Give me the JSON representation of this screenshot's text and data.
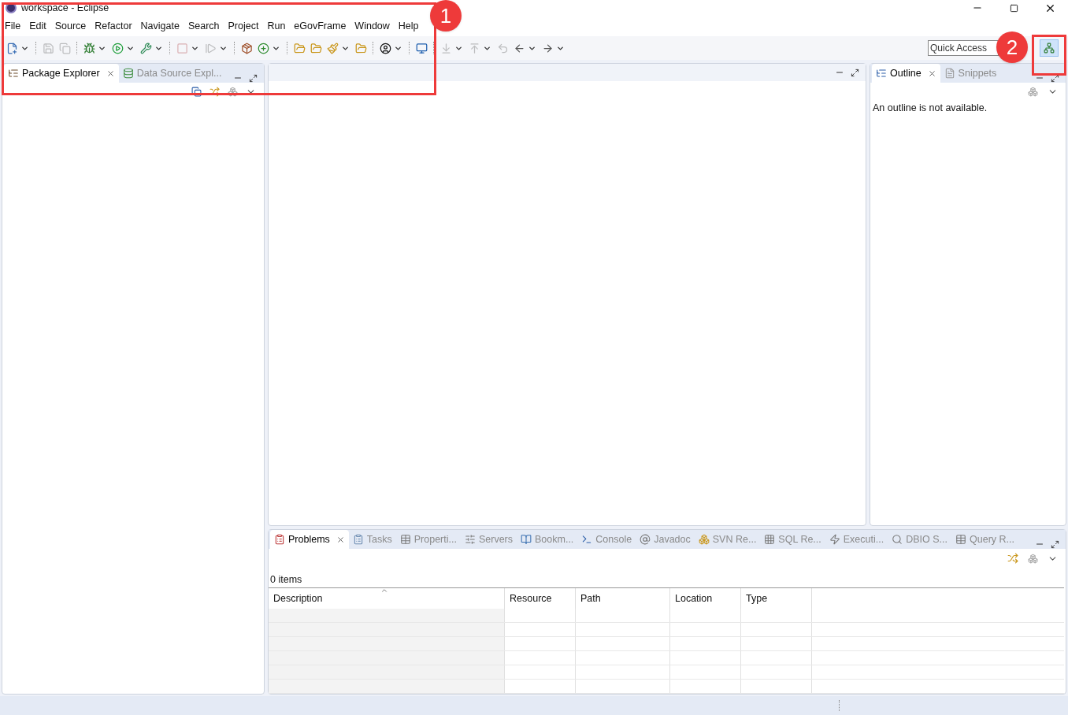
{
  "window": {
    "title": "workspace - Eclipse"
  },
  "menu": [
    "File",
    "Edit",
    "Source",
    "Refactor",
    "Navigate",
    "Search",
    "Project",
    "Run",
    "eGovFrame",
    "Window",
    "Help"
  ],
  "toolbar": [
    {
      "kind": "new",
      "dropdown": true,
      "disabled": false
    },
    {
      "kind": "separator"
    },
    {
      "kind": "save",
      "dropdown": false,
      "disabled": true
    },
    {
      "kind": "save-all",
      "dropdown": false,
      "disabled": true
    },
    {
      "kind": "separator"
    },
    {
      "kind": "debug",
      "dropdown": true,
      "disabled": false
    },
    {
      "kind": "run",
      "dropdown": true,
      "disabled": false
    },
    {
      "kind": "external",
      "dropdown": true,
      "disabled": false
    },
    {
      "kind": "separator"
    },
    {
      "kind": "stop",
      "dropdown": true,
      "disabled": true
    },
    {
      "kind": "step",
      "dropdown": true,
      "disabled": true
    },
    {
      "kind": "separator"
    },
    {
      "kind": "package",
      "dropdown": false,
      "disabled": false
    },
    {
      "kind": "class",
      "dropdown": true,
      "disabled": false
    },
    {
      "kind": "separator"
    },
    {
      "kind": "folder",
      "dropdown": false,
      "disabled": false
    },
    {
      "kind": "folder",
      "dropdown": false,
      "disabled": false
    },
    {
      "kind": "brush",
      "dropdown": true,
      "disabled": false
    },
    {
      "kind": "folder",
      "dropdown": false,
      "disabled": false
    },
    {
      "kind": "separator"
    },
    {
      "kind": "user",
      "dropdown": true,
      "disabled": false
    },
    {
      "kind": "separator"
    },
    {
      "kind": "monitor",
      "dropdown": false,
      "disabled": false
    },
    {
      "kind": "separator"
    },
    {
      "kind": "down",
      "dropdown": true,
      "disabled": true
    },
    {
      "kind": "up",
      "dropdown": true,
      "disabled": true
    },
    {
      "kind": "back",
      "dropdown": false,
      "disabled": true
    },
    {
      "kind": "left",
      "dropdown": true,
      "disabled": false
    },
    {
      "kind": "right",
      "dropdown": true,
      "disabled": false
    }
  ],
  "quick_access": {
    "placeholder": "Quick Access"
  },
  "left_panel": {
    "tabs": [
      {
        "label": "Package Explorer",
        "selected": true
      },
      {
        "label": "Data Source Expl...",
        "selected": false
      }
    ]
  },
  "outline_panel": {
    "tabs": [
      {
        "label": "Outline",
        "selected": true
      },
      {
        "label": "Snippets",
        "selected": false
      }
    ],
    "message": "An outline is not available."
  },
  "bottom_panel": {
    "tabs": [
      {
        "label": "Problems",
        "selected": true
      },
      {
        "label": "Tasks",
        "selected": false
      },
      {
        "label": "Properti...",
        "selected": false
      },
      {
        "label": "Servers",
        "selected": false
      },
      {
        "label": "Bookm...",
        "selected": false
      },
      {
        "label": "Console",
        "selected": false
      },
      {
        "label": "Javadoc",
        "selected": false
      },
      {
        "label": "SVN Re...",
        "selected": false
      },
      {
        "label": "SQL Re...",
        "selected": false
      },
      {
        "label": "Executi...",
        "selected": false
      },
      {
        "label": "DBIO S...",
        "selected": false
      },
      {
        "label": "Query R...",
        "selected": false
      }
    ],
    "count": "0 items",
    "columns": [
      "Description",
      "Resource",
      "Path",
      "Location",
      "Type"
    ]
  },
  "callouts": [
    {
      "label": "1"
    },
    {
      "label": "2"
    }
  ]
}
